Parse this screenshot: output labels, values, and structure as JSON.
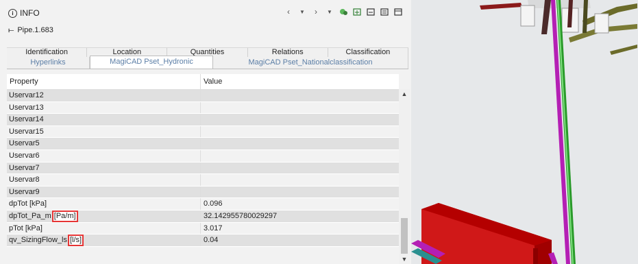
{
  "header": {
    "title": "INFO",
    "subtitle": "Pipe.1.683"
  },
  "toolbar": {
    "icons": [
      "chevron-left-icon",
      "chevron-down-icon",
      "chevron-right-icon",
      "dropdown-icon",
      "filter-icon",
      "expand-icon",
      "collapse-icon",
      "collapse-all-icon",
      "window-icon"
    ]
  },
  "tabs_row1": [
    "Identification",
    "Location",
    "Quantities",
    "Relations",
    "Classification"
  ],
  "tabs_row2": [
    "Hyperlinks",
    "MagiCAD Pset_Hydronic",
    "MagiCAD Pset_Nationalclassification"
  ],
  "active_tab": "MagiCAD Pset_Hydronic",
  "grid": {
    "col_property": "Property",
    "col_value": "Value",
    "rows": [
      {
        "property": "Uservar12",
        "value": ""
      },
      {
        "property": "Uservar13",
        "value": ""
      },
      {
        "property": "Uservar14",
        "value": ""
      },
      {
        "property": "Uservar15",
        "value": ""
      },
      {
        "property": "Uservar5",
        "value": ""
      },
      {
        "property": "Uservar6",
        "value": ""
      },
      {
        "property": "Uservar7",
        "value": ""
      },
      {
        "property": "Uservar8",
        "value": ""
      },
      {
        "property": "Uservar9",
        "value": ""
      },
      {
        "property": "dpTot [kPa]",
        "value": "0.096"
      },
      {
        "property": "dpTot_Pa_m",
        "unit": "[Pa/m]",
        "value": "32.142955780029297"
      },
      {
        "property": "pTot [kPa]",
        "value": "3.017"
      },
      {
        "property": "qv_SizingFlow_ls",
        "unit": "[l/s]",
        "value": "0.04"
      }
    ]
  },
  "colors": {
    "highlight": "#e53535",
    "tab_text": "#5b7ea6",
    "row_alt": "#e0e0e0"
  }
}
